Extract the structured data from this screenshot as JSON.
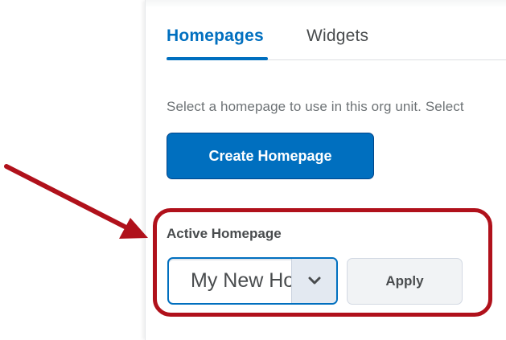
{
  "tabs": [
    {
      "label": "Homepages",
      "selected": true
    },
    {
      "label": "Widgets",
      "selected": false
    }
  ],
  "description": "Select a homepage to use in this org unit. Select",
  "create_button": {
    "label": "Create Homepage"
  },
  "active_homepage": {
    "label": "Active Homepage",
    "select_value": "My New Homepage",
    "apply_label": "Apply"
  },
  "icons": {
    "dropdown": "chevron-down-icon",
    "annotation_arrow": "red-arrow-icon"
  },
  "colors": {
    "accent": "#006fbf",
    "annotation": "#b0111b",
    "text": "#494c4e",
    "muted_text": "#6e7376"
  }
}
